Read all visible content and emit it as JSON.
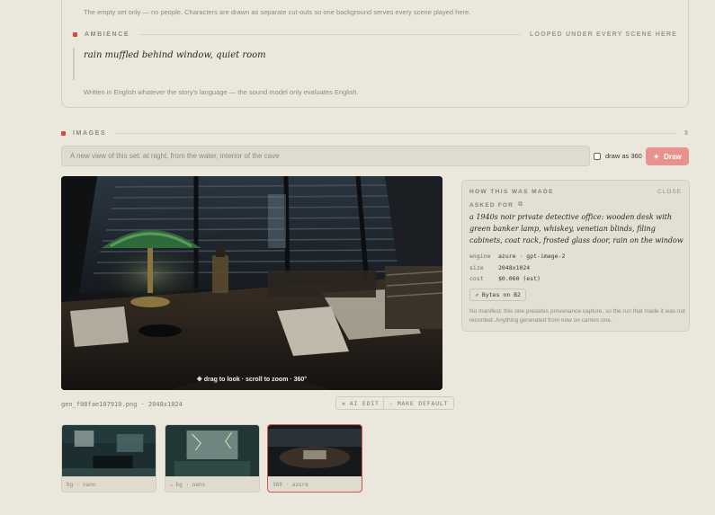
{
  "set_note": "The empty set only — no people. Characters are drawn as separate cut-outs so one background serves every scene played here.",
  "ambience": {
    "label": "AMBIENCE",
    "right_note": "LOOPED UNDER EVERY SCENE HERE",
    "text": "rain muffled behind window, quiet room",
    "note": "Written in English whatever the story's language — the sound model only evaluates English."
  },
  "images": {
    "label": "IMAGES",
    "count": "3",
    "prompt_placeholder": "A new view of this set: at night, from the water, interior of the cave",
    "draw_360_label": "draw as 360",
    "draw_label": "Draw",
    "drag_hint": "drag to look · scroll to zoom · 360°",
    "file_info": "gen_f08fae107910.png · 2048x1024",
    "ai_edit_label": "AI EDIT",
    "make_default_label": "MAKE DEFAULT"
  },
  "provenance": {
    "title": "HOW THIS WAS MADE",
    "close_label": "CLOSE",
    "asked_for_label": "ASKED FOR",
    "prompt": "a 1940s noir private detective office: wooden desk with green banker lamp, whiskey, venetian blinds, filing cabinets, coat rack, frosted glass door, rain on the window",
    "engine_key": "engine",
    "engine_value": "azure · gpt-image-2",
    "size_key": "size",
    "size_value": "2048x1024",
    "cost_key": "cost",
    "cost_value": "$0.060 (est)",
    "bytes_label": "Bytes on B2",
    "footnote": "No manifest: this one predates provenance capture, so the run that made it was not recorded. Anything generated from now on carries one."
  },
  "thumbnails": [
    {
      "caption": "bg · nano",
      "starred": false,
      "active": false
    },
    {
      "caption": "bg · nano",
      "starred": true,
      "active": false
    },
    {
      "caption": "360 · azure",
      "starred": false,
      "active": true
    }
  ],
  "colors": {
    "background": "#ebe7dd",
    "accent_red": "#d24b44",
    "draw_button": "#e8928d"
  },
  "icons": {
    "draw": "sparkle-icon",
    "drag": "move-icon",
    "ai_edit": "wand-icon",
    "make_default": "star-icon",
    "copy": "copy-icon",
    "external": "external-link-icon"
  }
}
